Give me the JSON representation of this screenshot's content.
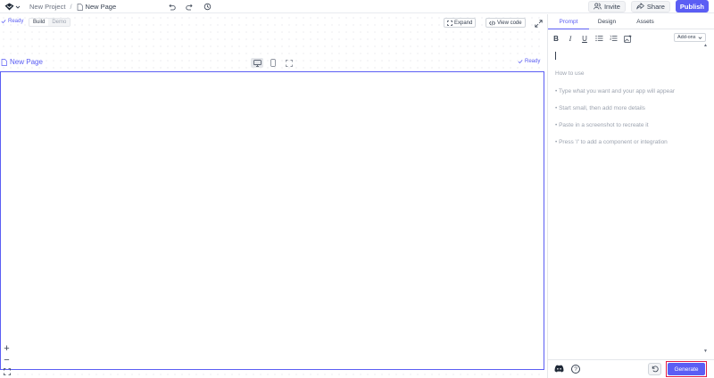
{
  "header": {
    "logo_icon": "cube-logo-icon",
    "breadcrumb": {
      "project": "New Project",
      "separator": "/",
      "page": "New Page"
    },
    "invite_label": "Invite",
    "share_label": "Share",
    "publish_label": "Publish",
    "accent_color": "#5b5ef4"
  },
  "canvas": {
    "status": "Ready",
    "modes": [
      "Build",
      "Demo"
    ],
    "expand_label": "Expand",
    "view_code_label": "View code",
    "page_title": "New Page",
    "page_status": "Ready",
    "zoom_in": "+",
    "zoom_out": "−"
  },
  "panel": {
    "tabs": [
      "Prompt",
      "Design",
      "Assets"
    ],
    "addons_label": "Add-ons",
    "how_to_title": "How to use",
    "tips": [
      "• Type what you want and your app will appear",
      "• Start small, then add more details",
      "• Paste in a screenshot to recreate it",
      "• Press '/' to add a component or integration"
    ],
    "help_label": "?",
    "generate_label": "Generate",
    "highlight_color": "#e11d48"
  }
}
